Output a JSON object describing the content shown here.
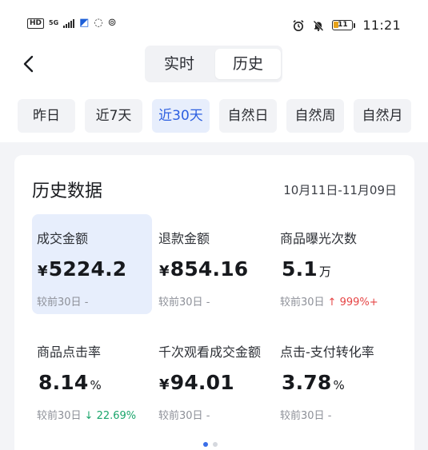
{
  "status_bar": {
    "hd": "HD",
    "network": "5G",
    "time": "11:21",
    "battery": "11"
  },
  "nav": {
    "tabs": [
      {
        "label": "实时",
        "active": false
      },
      {
        "label": "历史",
        "active": true
      }
    ]
  },
  "ranges": [
    {
      "label": "昨日",
      "active": false
    },
    {
      "label": "近7天",
      "active": false
    },
    {
      "label": "近30天",
      "active": true
    },
    {
      "label": "自然日",
      "active": false
    },
    {
      "label": "自然周",
      "active": false
    },
    {
      "label": "自然月",
      "active": false
    }
  ],
  "card": {
    "title": "历史数据",
    "date_range": "10月11日-11月09日",
    "metrics": [
      {
        "label": "成交金额",
        "currency": "¥",
        "value": "5224.2",
        "unit": "",
        "compare": "较前30日",
        "change": "-",
        "trend": "none",
        "highlighted": true
      },
      {
        "label": "退款金额",
        "currency": "¥",
        "value": "854.16",
        "unit": "",
        "compare": "较前30日",
        "change": "-",
        "trend": "none",
        "highlighted": false
      },
      {
        "label": "商品曝光次数",
        "currency": "",
        "value": "5.1",
        "unit": "万",
        "compare": "较前30日",
        "change": "↑ 999%+",
        "trend": "up",
        "highlighted": false
      },
      {
        "label": "商品点击率",
        "currency": "",
        "value": "8.14",
        "unit": "%",
        "compare": "较前30日",
        "change": "↓ 22.69%",
        "trend": "down",
        "highlighted": false
      },
      {
        "label": "千次观看成交金额",
        "currency": "¥",
        "value": "94.01",
        "unit": "",
        "compare": "较前30日",
        "change": "-",
        "trend": "none",
        "highlighted": false
      },
      {
        "label": "点击-支付转化率",
        "currency": "",
        "value": "3.78",
        "unit": "%",
        "compare": "较前30日",
        "change": "-",
        "trend": "none",
        "highlighted": false
      }
    ]
  },
  "colors": {
    "accent": "#2c5fe0",
    "highlight_bg": "#e7eefc",
    "up": "#e64545",
    "down": "#1aa56b"
  }
}
